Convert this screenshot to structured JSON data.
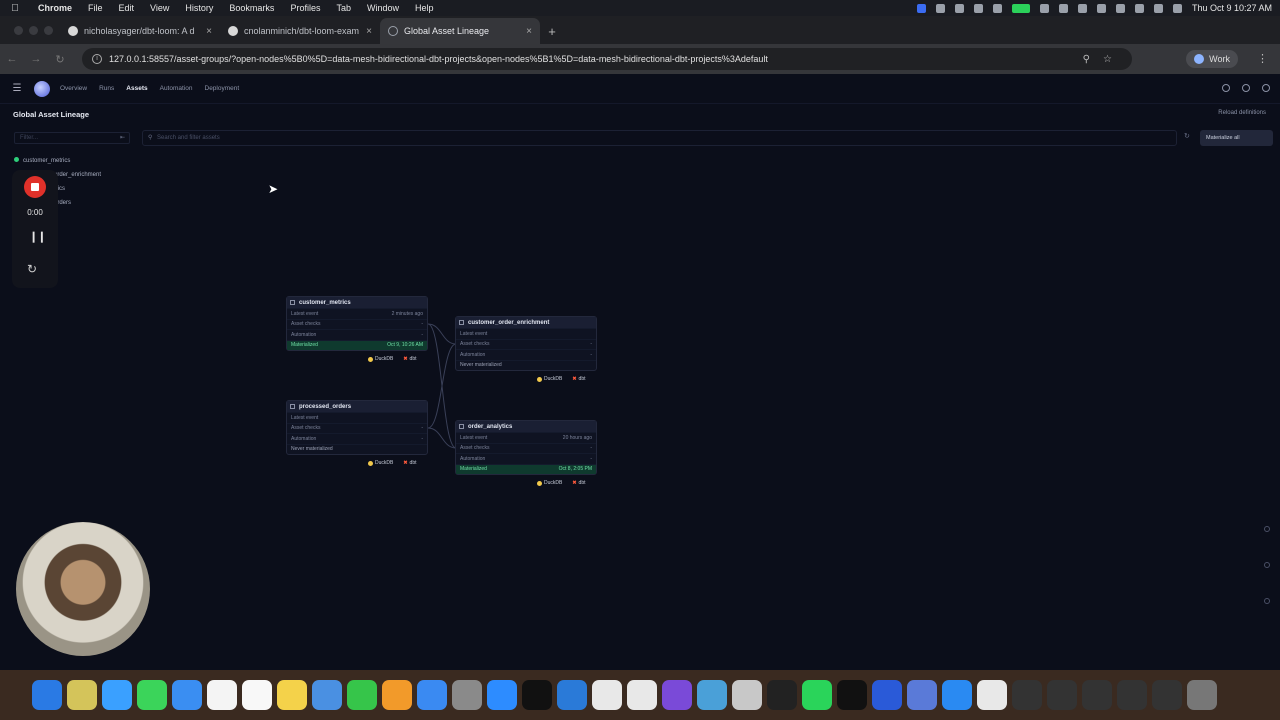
{
  "menubar": {
    "app": "Chrome",
    "items": [
      "File",
      "Edit",
      "View",
      "History",
      "Bookmarks",
      "Profiles",
      "Tab",
      "Window",
      "Help"
    ],
    "clock": "Thu Oct 9  10:27 AM"
  },
  "tabs": [
    {
      "title": "nicholasyager/dbt-loom: A d",
      "icon": "github"
    },
    {
      "title": "cnolanminich/dbt-loom-exam",
      "icon": "github"
    },
    {
      "title": "Global Asset Lineage",
      "icon": "globe"
    }
  ],
  "address": {
    "url": "127.0.0.1:58557/asset-groups/?open-nodes%5B0%5D=data-mesh-bidirectional-dbt-projects&open-nodes%5B1%5D=data-mesh-bidirectional-dbt-projects%3Adefault",
    "profile": "Work"
  },
  "app": {
    "nav": [
      "Overview",
      "Runs",
      "Assets",
      "Automation",
      "Deployment"
    ],
    "page_title": "Global Asset Lineage",
    "reload_label": "Reload definitions",
    "filter_placeholder": "Filter...",
    "search_placeholder": "Search and filter assets",
    "materialize_label": "Materialize all",
    "tree": [
      "customer_metrics",
      "order_enrichment",
      "rtics",
      "orders"
    ]
  },
  "recorder": {
    "time": "0:00"
  },
  "nodes": [
    {
      "name": "customer_metrics",
      "latest_event": "2 minutes ago",
      "asset_checks": "-",
      "automation": "-",
      "status": "Materialized",
      "status_time": "Oct 9, 10:26 AM"
    },
    {
      "name": "customer_order_enrichment",
      "latest_event": "",
      "asset_checks": "-",
      "automation": "-",
      "status": "Never materialized",
      "status_time": ""
    },
    {
      "name": "processed_orders",
      "latest_event": "",
      "asset_checks": "-",
      "automation": "-",
      "status": "Never materialized",
      "status_time": ""
    },
    {
      "name": "order_analytics",
      "latest_event": "20 hours ago",
      "asset_checks": "-",
      "automation": "-",
      "status": "Materialized",
      "status_time": "Oct 8, 2:05 PM"
    }
  ],
  "row_labels": {
    "latest_event": "Latest event",
    "asset_checks": "Asset checks",
    "automation": "Automation"
  },
  "tag_labels": {
    "duckdb": "DuckDB",
    "dbt": "dbt"
  },
  "colors": {
    "materialized": "#6fe0a6",
    "recording": "#e0312a",
    "background": "#0b0e1a"
  }
}
